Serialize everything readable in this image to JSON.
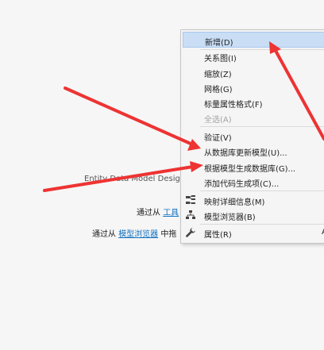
{
  "designer": {
    "title_line": "Entity Data Model Desig",
    "toolbox_prefix": "通过从",
    "toolbox_link": "工具",
    "browser_prefix": "通过从",
    "browser_link": "模型浏览器",
    "browser_suffix": "中拖"
  },
  "menu": {
    "items": [
      {
        "label": "新增(D)",
        "highlighted": true
      },
      {
        "label": "关系图(I)"
      },
      {
        "label": "缩放(Z)"
      },
      {
        "label": "网格(G)"
      },
      {
        "label": "标量属性格式(F)"
      },
      {
        "label": "全选(A)",
        "disabled": true
      },
      {
        "label": "验证(V)"
      },
      {
        "label": "从数据库更新模型(U)..."
      },
      {
        "label": "根据模型生成数据库(G)..."
      },
      {
        "label": "添加代码生成项(C)..."
      },
      {
        "label": "映射详细信息(M)",
        "icon": "mapping-details-icon"
      },
      {
        "label": "模型浏览器(B)",
        "icon": "model-browser-icon"
      },
      {
        "label": "属性(R)",
        "icon": "wrench-icon",
        "shortcut": "A"
      }
    ]
  },
  "colors": {
    "arrow": "#ee3333",
    "highlight": "#c9def5",
    "link": "#0e70c0"
  }
}
